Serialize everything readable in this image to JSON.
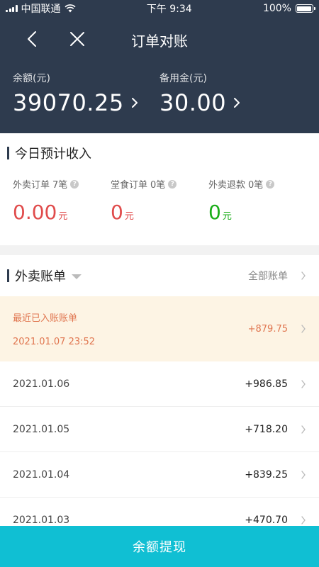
{
  "status_bar": {
    "carrier": "中国联通",
    "time": "下午 9:34",
    "battery": "100%"
  },
  "nav": {
    "title": "订单对账"
  },
  "balance": {
    "label": "余额(元)",
    "value": "39070.25"
  },
  "reserve": {
    "label": "备用金(元)",
    "value": "30.00"
  },
  "income": {
    "title": "今日预计收入",
    "items": [
      {
        "label": "外卖订单",
        "count": "7笔",
        "value": "0.00",
        "unit": "元",
        "color": "#e04b4b"
      },
      {
        "label": "堂食订单",
        "count": "0笔",
        "value": "0",
        "unit": "元",
        "color": "#e04b4b"
      },
      {
        "label": "外卖退款",
        "count": "0笔",
        "value": "0",
        "unit": "元",
        "color": "#1aad19"
      }
    ],
    "help_icon": "question-icon"
  },
  "bills": {
    "title": "外卖账单",
    "all_label": "全部账单",
    "recent": {
      "title": "最近已入账账单",
      "date": "2021.01.07 23:52",
      "amount": "+879.75"
    },
    "rows": [
      {
        "date": "2021.01.06",
        "amount": "+986.85"
      },
      {
        "date": "2021.01.05",
        "amount": "+718.20"
      },
      {
        "date": "2021.01.04",
        "amount": "+839.25"
      },
      {
        "date": "2021.01.03",
        "amount": "+470.70"
      }
    ]
  },
  "withdraw": {
    "label": "余额提现"
  },
  "colors": {
    "header_bg": "#2e3b4e",
    "accent": "#10bfd3",
    "red": "#e04b4b",
    "green": "#1aad19",
    "recent_bg": "#fdf4e4"
  }
}
